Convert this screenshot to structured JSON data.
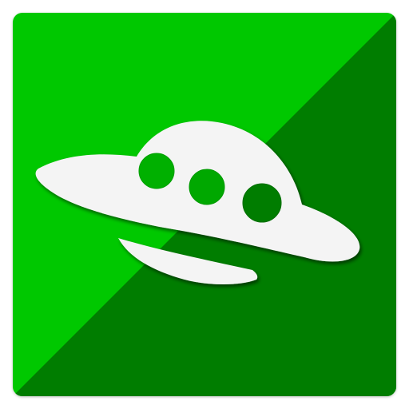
{
  "icon": {
    "name": "ufo-icon",
    "colors": {
      "light_green": "#00C800",
      "dark_green": "#007D00",
      "saucer": "#F4F4F4",
      "shadow": "#0A3A0A"
    }
  }
}
